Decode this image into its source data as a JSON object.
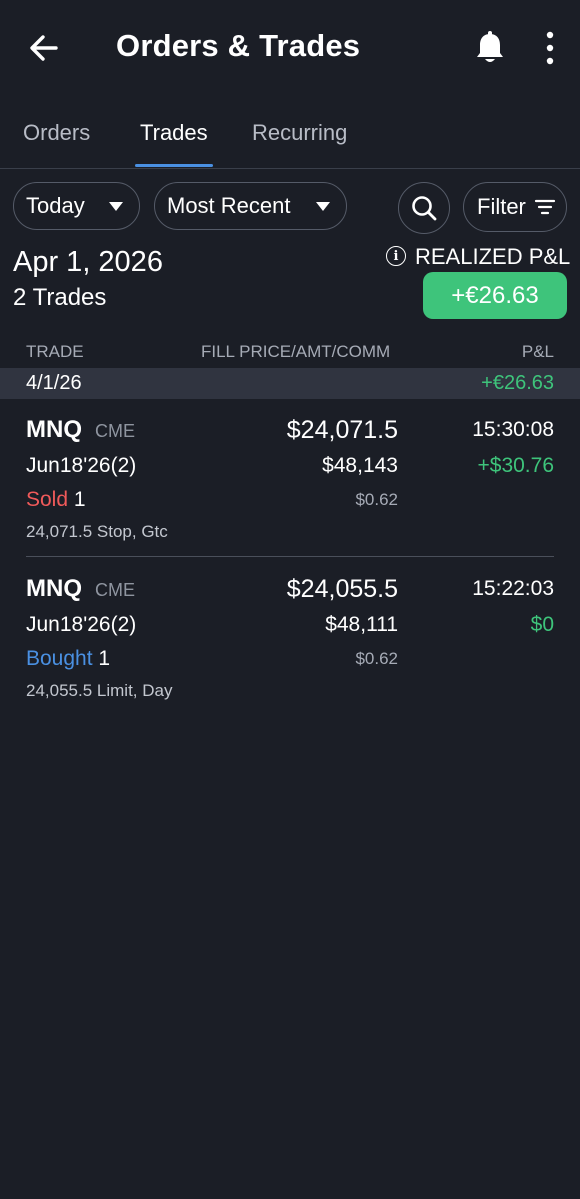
{
  "header": {
    "title": "Orders & Trades",
    "back_icon": "arrow-left-icon",
    "bell_icon": "bell-icon",
    "more_icon": "more-vertical-icon"
  },
  "tabs": [
    {
      "label": "Orders",
      "active": false
    },
    {
      "label": "Trades",
      "active": true
    },
    {
      "label": "Recurring",
      "active": false
    }
  ],
  "filters": {
    "period": "Today",
    "sort": "Most Recent",
    "filter_label": "Filter"
  },
  "summary": {
    "date": "Apr 1, 2026",
    "count": "2 Trades",
    "realized_label": "REALIZED P&L",
    "realized_value": "+€26.63"
  },
  "columns": {
    "trade": "TRADE",
    "fill": "FILL PRICE/AMT/COMM",
    "pnl": "P&L"
  },
  "group": {
    "date": "4/1/26",
    "pnl": "+€26.63"
  },
  "trades": [
    {
      "symbol": "MNQ",
      "exchange": "CME",
      "price": "$24,071.5",
      "time": "15:30:08",
      "contract": "Jun18'26(2)",
      "amount": "$48,143",
      "pnl": "+$30.76",
      "action": "Sold",
      "qty": "1",
      "commission": "$0.62",
      "detail": "24,071.5 Stop, Gtc"
    },
    {
      "symbol": "MNQ",
      "exchange": "CME",
      "price": "$24,055.5",
      "time": "15:22:03",
      "contract": "Jun18'26(2)",
      "amount": "$48,111",
      "pnl": "$0",
      "action": "Bought",
      "qty": "1",
      "commission": "$0.62",
      "detail": "24,055.5 Limit, Day"
    }
  ],
  "colors": {
    "background": "#1b1e26",
    "accent_blue": "#4a90e2",
    "positive_green": "#3ec47b",
    "sold_red": "#f05a5a"
  }
}
